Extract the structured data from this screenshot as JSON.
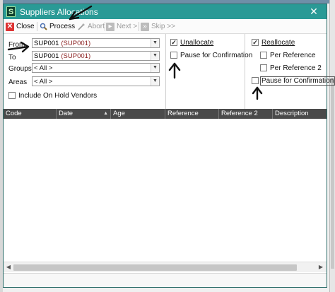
{
  "window": {
    "title": "Suppliers Allocations",
    "app_icon_glyph": "S",
    "close_glyph": "✕",
    "accent_color": "#2a9a96"
  },
  "toolbar": {
    "close_label": "Close",
    "process_label": "Process",
    "abort_label": "Abort",
    "next_label": "Next >",
    "skip_label": "Skip >>"
  },
  "filters": {
    "from": {
      "label": "From",
      "code": "SUP001",
      "name": "(SUP001)"
    },
    "to": {
      "label": "To",
      "code": "SUP001",
      "name": "(SUP001)"
    },
    "groups": {
      "label": "Groups",
      "value": "< All >"
    },
    "areas": {
      "label": "Areas",
      "value": "< All >"
    },
    "include_on_hold": {
      "label": "Include On Hold Vendors",
      "checked": false
    }
  },
  "unallocate_panel": {
    "unallocate": {
      "label": "Unallocate",
      "checked": true
    },
    "pause_for_confirmation": {
      "label": "Pause for Confirmation",
      "checked": false
    }
  },
  "reallocate_panel": {
    "reallocate": {
      "label": "Reallocate",
      "checked": true
    },
    "per_reference": {
      "label": "Per Reference",
      "checked": false
    },
    "per_reference_2": {
      "label": "Per Reference 2",
      "checked": false
    },
    "pause_for_confirmation": {
      "label": "Pause for Confirmation",
      "checked": false
    }
  },
  "grid": {
    "columns": [
      "Code",
      "Date",
      "Age",
      "Reference",
      "Reference 2",
      "Description"
    ],
    "rows": []
  },
  "icons": {
    "close": "close-icon",
    "process": "magnifier-icon",
    "abort": "abort-icon",
    "next": "next-icon",
    "skip": "skip-icon",
    "dropdown": "chevron-down-icon",
    "check": "✓",
    "sort": "▲"
  }
}
